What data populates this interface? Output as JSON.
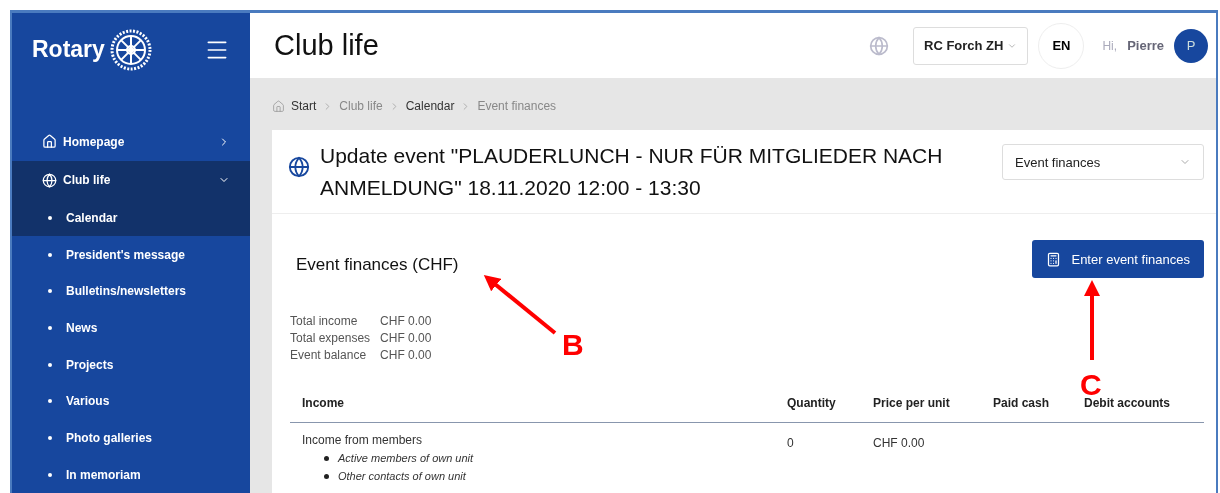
{
  "sidebar": {
    "logo": "Rotary",
    "items": [
      {
        "label": "Homepage",
        "expanded": false,
        "selected": false
      },
      {
        "label": "Club life",
        "expanded": true,
        "selected": true,
        "children": [
          {
            "label": "Calendar",
            "selected": true
          },
          {
            "label": "President's message",
            "selected": false
          },
          {
            "label": "Bulletins/newsletters",
            "selected": false
          },
          {
            "label": "News",
            "selected": false
          },
          {
            "label": "Projects",
            "selected": false
          },
          {
            "label": "Various",
            "selected": false
          },
          {
            "label": "Photo galleries",
            "selected": false
          },
          {
            "label": "In memoriam",
            "selected": false
          }
        ]
      }
    ]
  },
  "header": {
    "title": "Club life",
    "club": "RC Forch ZH",
    "language": "EN",
    "greeting": "Hi,",
    "user": "Pierre",
    "avatar": "P"
  },
  "breadcrumb": [
    "Start",
    "Club life",
    "Calendar",
    "Event finances"
  ],
  "event": {
    "title": "Update event \"PLAUDERLUNCH - NUR FÜR MITGLIEDER NACH ANMELDUNG\" 18.11.2020 12:00 - 13:30",
    "view_select": "Event finances"
  },
  "finances": {
    "heading": "Event finances (CHF)",
    "button": "Enter event finances",
    "summary": [
      {
        "label": "Total income",
        "value": "CHF 0.00"
      },
      {
        "label": "Total expenses",
        "value": "CHF 0.00"
      },
      {
        "label": "Event balance",
        "value": "CHF 0.00"
      }
    ],
    "table": {
      "columns": [
        "Income",
        "Quantity",
        "Price per unit",
        "Paid cash",
        "Debit accounts"
      ],
      "rows": [
        {
          "name": "Income from members",
          "quantity": "0",
          "price": "CHF 0.00",
          "bullets": [
            "Active members of own unit",
            "Other contacts of own unit"
          ]
        }
      ]
    }
  },
  "annotations": [
    {
      "label": "B"
    },
    {
      "label": "C"
    }
  ]
}
